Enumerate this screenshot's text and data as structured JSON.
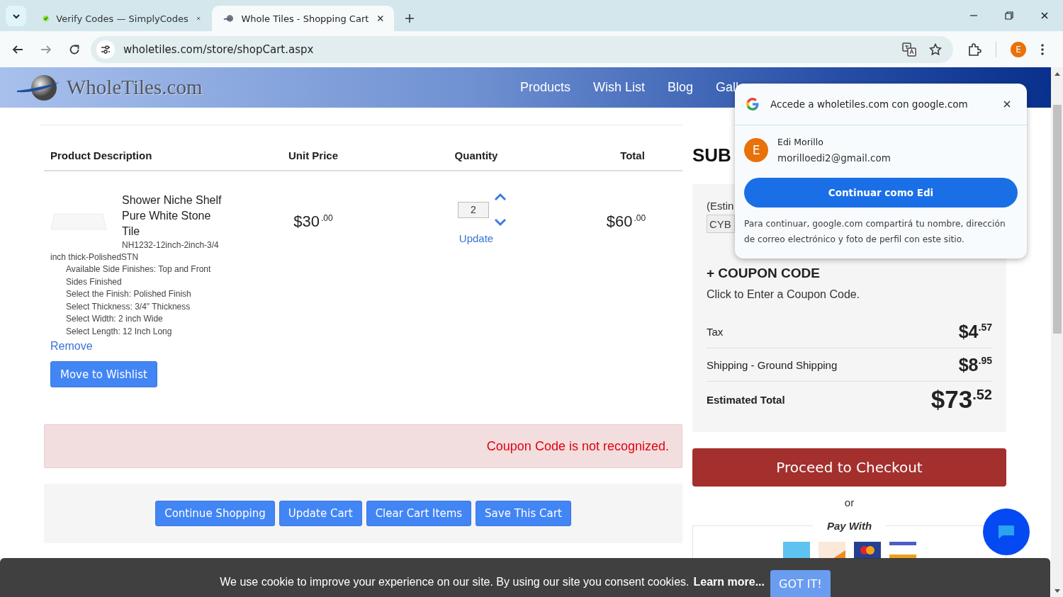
{
  "browser": {
    "tabs": [
      {
        "title": "Verify Codes — SimplyCodes",
        "selected": false
      },
      {
        "title": "Whole Tiles - Shopping Cart",
        "selected": true
      }
    ],
    "url": "wholetiles.com/store/shopCart.aspx",
    "profile_letter": "E"
  },
  "site": {
    "logo_text": "WholeTiles.com",
    "nav": [
      "Products",
      "Wish List",
      "Blog",
      "Gall"
    ]
  },
  "cart": {
    "columns": [
      "Product Description",
      "Unit Price",
      "Quantity",
      "Total"
    ],
    "items": [
      {
        "name": "Shower Niche Shelf Pure White Stone Tile",
        "sku": "NH1232-12inch-2inch-3/4 inch thick-PolishedSTN",
        "options": [
          "Available Side Finishes: Top and Front Sides Finished",
          "Select the Finish: Polished Finish",
          "Select Thickness: 3/4\" Thickness",
          "Select Width: 2 inch Wide",
          "Select Length: 12 Inch Long"
        ],
        "unit_price": "$30$^{.00}$",
        "quantity": "2",
        "update": "Update",
        "total": "$60$^{.00}$",
        "remove": "Remove",
        "wishlist": "Move to Wishlist"
      }
    ],
    "alert": "Coupon Code is not recognized.",
    "actions": [
      "Continue Shopping",
      "Update Cart",
      "Clear Cart Items",
      "Save This Cart"
    ]
  },
  "summary": {
    "heading": "SUB",
    "estimate_label": "(Estin",
    "zip_value": "CYB",
    "coupon_heading": "+ COUPON CODE",
    "coupon_hint": "Click to Enter a Coupon Code.",
    "lines": [
      {
        "kind": "line",
        "label": "Tax",
        "amount": "$4$^{.57}$"
      },
      {
        "kind": "line",
        "label": "Shipping - Ground Shipping",
        "amount": "$8$^{.95}$"
      },
      {
        "kind": "total",
        "label": "Estimated Total",
        "amount": "$73$^{.52}$"
      }
    ],
    "checkout": "Proceed to Checkout",
    "or": "or",
    "pay_with": "Pay With"
  },
  "google_popup": {
    "title": "Accede a wholetiles.com con google.com",
    "avatar_letter": "E",
    "name": "Edi Morillo",
    "email": "morilloedi2@gmail.com",
    "button": "Continuar como Edi",
    "notice": "Para continuar, google.com compartirá tu nombre, dirección de correo electrónico y foto de perfil con este sitio."
  },
  "cookie_bar": {
    "message": "We use cookie to improve your experience on our site. By using our site you consent cookies.",
    "link": "Learn more...",
    "button": "GOT IT!"
  }
}
